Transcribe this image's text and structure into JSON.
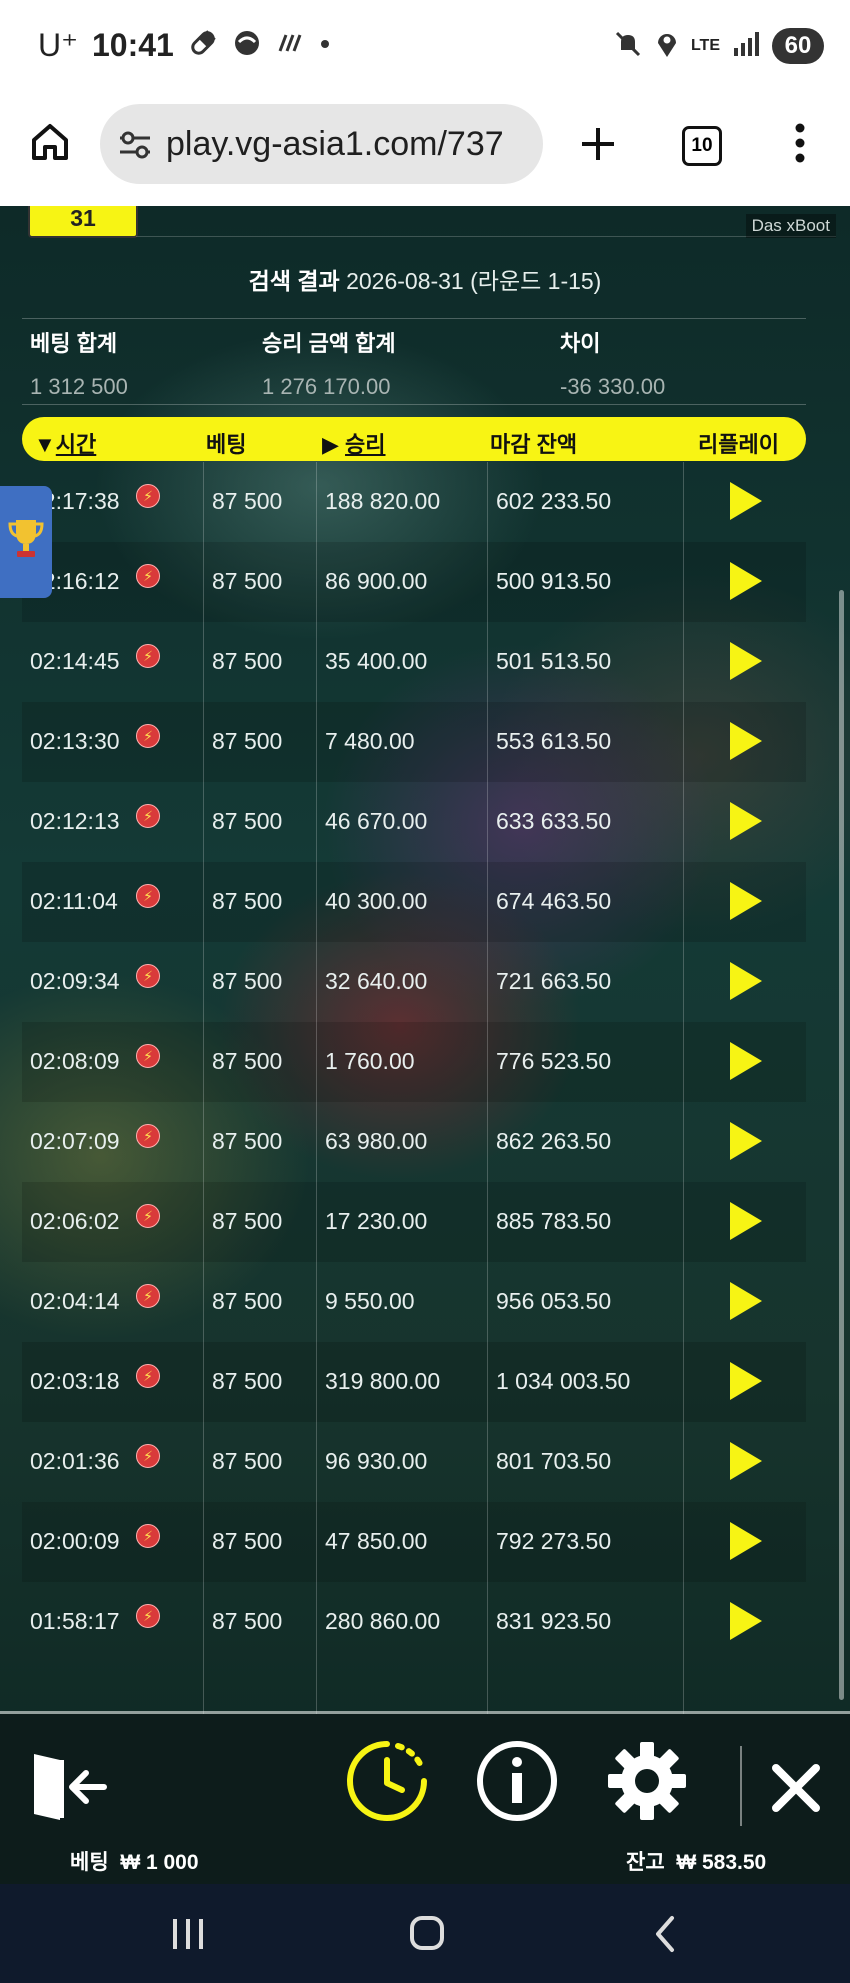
{
  "status_bar": {
    "carrier": "U⁺",
    "time": "10:41",
    "battery": "60",
    "network": "LTE"
  },
  "browser": {
    "url": "play.vg-asia1.com/737",
    "tab_count": "10"
  },
  "game": {
    "date_chip": "31",
    "provider_tag": "Das xBoot",
    "search_label": "검색 결과",
    "search_date": "2026-08-31 (라운드 1-15)",
    "summary": {
      "bet_total_label": "베팅 합계",
      "bet_total_value": "1 312 500",
      "win_total_label": "승리 금액 합계",
      "win_total_value": "1 276 170.00",
      "diff_label": "차이",
      "diff_value": "-36 330.00"
    },
    "table": {
      "headers": {
        "time": "시간",
        "bet": "베팅",
        "win": "승리",
        "balance": "마감 잔액",
        "replay": "리플레이"
      },
      "rows": [
        {
          "time": "02:17:38",
          "bet": "87 500",
          "win": "188 820.00",
          "balance": "602 233.50"
        },
        {
          "time": "02:16:12",
          "bet": "87 500",
          "win": "86 900.00",
          "balance": "500 913.50"
        },
        {
          "time": "02:14:45",
          "bet": "87 500",
          "win": "35 400.00",
          "balance": "501 513.50"
        },
        {
          "time": "02:13:30",
          "bet": "87 500",
          "win": "7 480.00",
          "balance": "553 613.50"
        },
        {
          "time": "02:12:13",
          "bet": "87 500",
          "win": "46 670.00",
          "balance": "633 633.50"
        },
        {
          "time": "02:11:04",
          "bet": "87 500",
          "win": "40 300.00",
          "balance": "674 463.50"
        },
        {
          "time": "02:09:34",
          "bet": "87 500",
          "win": "32 640.00",
          "balance": "721 663.50"
        },
        {
          "time": "02:08:09",
          "bet": "87 500",
          "win": "1 760.00",
          "balance": "776 523.50"
        },
        {
          "time": "02:07:09",
          "bet": "87 500",
          "win": "63 980.00",
          "balance": "862 263.50"
        },
        {
          "time": "02:06:02",
          "bet": "87 500",
          "win": "17 230.00",
          "balance": "885 783.50"
        },
        {
          "time": "02:04:14",
          "bet": "87 500",
          "win": "9 550.00",
          "balance": "956 053.50"
        },
        {
          "time": "02:03:18",
          "bet": "87 500",
          "win": "319 800.00",
          "balance": "1 034 003.50"
        },
        {
          "time": "02:01:36",
          "bet": "87 500",
          "win": "96 930.00",
          "balance": "801 703.50"
        },
        {
          "time": "02:00:09",
          "bet": "87 500",
          "win": "47 850.00",
          "balance": "792 273.50"
        },
        {
          "time": "01:58:17",
          "bet": "87 500",
          "win": "280 860.00",
          "balance": "831 923.50"
        }
      ]
    },
    "footer": {
      "bet_label": "베팅",
      "bet_value": "₩ 1 000",
      "balance_label": "잔고",
      "balance_value": "₩ 583.50"
    }
  },
  "colors": {
    "accent_yellow": "#f7f414",
    "bolt_red": "#d93a3a",
    "trophy_tab": "#3f6fc2"
  },
  "icons": [
    "home-icon",
    "site-settings-icon",
    "plus-icon",
    "tabs-icon",
    "more-icon",
    "trophy-icon",
    "lightning-icon",
    "play-icon",
    "exit-icon",
    "history-icon",
    "info-icon",
    "gear-icon",
    "close-icon",
    "recents-icon",
    "home-nav-icon",
    "back-icon"
  ]
}
